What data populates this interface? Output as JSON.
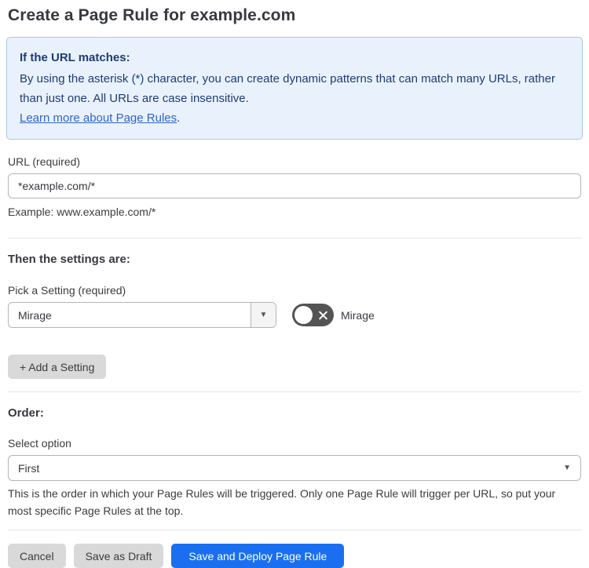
{
  "page": {
    "title": "Create a Page Rule for example.com"
  },
  "info_box": {
    "heading": "If the URL matches:",
    "body": "By using the asterisk (*) character, you can create dynamic patterns that can match many URLs, rather than just one. All URLs are case insensitive.",
    "link_label": "Learn more about Page Rules",
    "link_suffix": "."
  },
  "url_field": {
    "label": "URL (required)",
    "value": "*example.com/*",
    "helper": "Example: www.example.com/*"
  },
  "settings_section": {
    "heading": "Then the settings are:",
    "picker_label": "Pick a Setting (required)",
    "picker_value": "Mirage",
    "toggle_label": "Mirage",
    "toggle_state": "off",
    "add_button_label": "+ Add a Setting"
  },
  "order_section": {
    "heading": "Order:",
    "select_label": "Select option",
    "select_value": "First",
    "helper": "This is the order in which your Page Rules will be triggered. Only one Page Rule will trigger per URL, so put your most specific Page Rules at the top."
  },
  "footer": {
    "cancel_label": "Cancel",
    "save_draft_label": "Save as Draft",
    "save_deploy_label": "Save and Deploy Page Rule"
  },
  "colors": {
    "primary_blue": "#1a6ff0",
    "info_background": "#e9f2fc",
    "info_border": "#a9c7e8",
    "info_text": "#1d3c78",
    "link_blue": "#2f63cc",
    "toggle_off_gray": "#545454"
  }
}
